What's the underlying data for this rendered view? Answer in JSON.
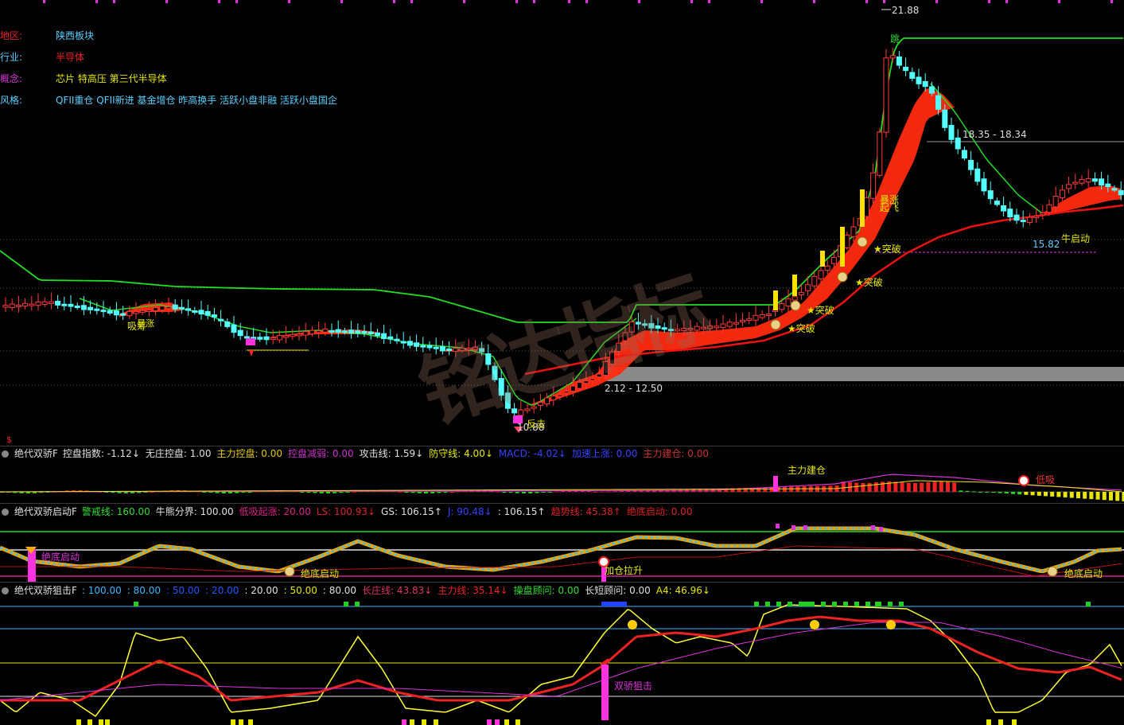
{
  "info": {
    "region_label": "地区:",
    "region_value": "陕西板块",
    "industry_label": "行业:",
    "industry_value": "半导体",
    "concept_label": "概念:",
    "concept_value": "芯片 特高压 第三代半导体",
    "style_label": "风格:",
    "style_value": "QFII重仓 QFII新进 基金增仓 昨高换手 活跃小盘非融 活跃小盘国企"
  },
  "dollar": "$",
  "watermark": "铭达指标",
  "main_chart": {
    "high_label": "21.88",
    "range_label_1": "18.35 - 18.34",
    "range_label_2": "2.12 - 12.50",
    "low_label": "10.88",
    "support_label": "15.82",
    "annotations": {
      "tiao": "跳",
      "baozhang": "暴涨",
      "qifei": "起飞",
      "tupo": "★突破",
      "niuqidong": "牛启动",
      "xishou": "吸筹",
      "baozhang_left": "暴涨",
      "fanji": "反击"
    },
    "colors": {
      "up": "#ff3a3a",
      "down": "#54ffff",
      "ribbon": "#ff2a10",
      "fast_ma": "#22dd22",
      "slow_ma": "#ee1111"
    }
  },
  "panel1": {
    "name": "绝代双骄F",
    "items": [
      {
        "text": "控盘指数: -1.12",
        "arrow": "↓",
        "color": "#e0e0e0"
      },
      {
        "text": "无庄控盘: 1.00",
        "arrow": "",
        "color": "#e0e0e0"
      },
      {
        "text": "主力控盘: 0.00",
        "arrow": "",
        "color": "#e6c800"
      },
      {
        "text": "控盘减弱: 0.00",
        "arrow": "",
        "color": "#cc33cc"
      },
      {
        "text": "攻击线: 1.59",
        "arrow": "↓",
        "color": "#e0e0e0"
      },
      {
        "text": "防守线: 4.00",
        "arrow": "↓",
        "color": "#e6e600"
      },
      {
        "text": "MACD: -4.02",
        "arrow": "↓",
        "color": "#3344ff"
      },
      {
        "text": "加速上涨: 0.00",
        "arrow": "",
        "color": "#3344ff"
      },
      {
        "text": "主力建仓: 0.00",
        "arrow": "",
        "color": "#cc3333"
      }
    ],
    "label_jiancang": "主力建仓",
    "label_dixi": "低吸"
  },
  "panel2": {
    "name": "绝代双骄启动F",
    "items": [
      {
        "text": "警戒线: 160.00",
        "arrow": "",
        "color": "#33dd33"
      },
      {
        "text": "牛熊分界: 100.00",
        "arrow": "",
        "color": "#e0e0e0"
      },
      {
        "text": "低吸起涨: 20.00",
        "arrow": "",
        "color": "#dd2288"
      },
      {
        "text": "LS: 100.93",
        "arrow": "↓",
        "color": "#dd2222"
      },
      {
        "text": "GS: 106.15",
        "arrow": "↑",
        "color": "#e0e0e0"
      },
      {
        "text": "J: 90.48",
        "arrow": "↓",
        "color": "#3344ff"
      },
      {
        "text": ": 106.15",
        "arrow": "↑",
        "color": "#e0e0e0"
      },
      {
        "text": "趋势线: 45.38",
        "arrow": "↑",
        "color": "#dd2222"
      },
      {
        "text": "绝底启动: 0.00",
        "arrow": "",
        "color": "#dd2222"
      }
    ],
    "label_left": "绝底启动",
    "label_mid": "绝底启动",
    "label_jiacang": "加仓拉升",
    "label_right": "绝底启动"
  },
  "panel3": {
    "name": "绝代双骄狙击F",
    "items": [
      {
        "text": ": 100.00",
        "arrow": "",
        "color": "#3fb8ff"
      },
      {
        "text": ": 80.00",
        "arrow": "",
        "color": "#3fb8ff"
      },
      {
        "text": ": 50.00",
        "arrow": "",
        "color": "#2255ff"
      },
      {
        "text": ": 20.00",
        "arrow": "",
        "color": "#2255ff"
      },
      {
        "text": ": 20.00",
        "arrow": "",
        "color": "#e0e0e0"
      },
      {
        "text": ": 50.00",
        "arrow": "",
        "color": "#e6e600"
      },
      {
        "text": ": 80.00",
        "arrow": "",
        "color": "#e0e0e0"
      },
      {
        "text": "长庄线: 43.83",
        "arrow": "↓",
        "color": "#dd3366"
      },
      {
        "text": "主力线: 35.14",
        "arrow": "↓",
        "color": "#ee2222"
      },
      {
        "text": "操盘顾问: 0.00",
        "arrow": "",
        "color": "#33dd33"
      },
      {
        "text": "长短顾问: 0.00",
        "arrow": "",
        "color": "#e0e0e0"
      },
      {
        "text": "A4: 46.96",
        "arrow": "↓",
        "color": "#e6e600"
      }
    ],
    "label_juji": "双骄狙击"
  }
}
